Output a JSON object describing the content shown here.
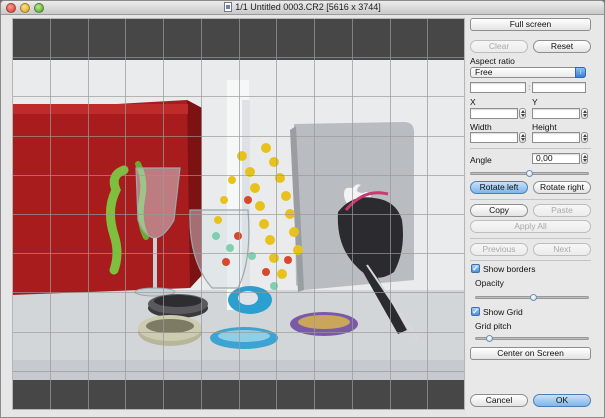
{
  "window": {
    "title": "1/1 Untitled 0003.CR2 [5616 x 3744]"
  },
  "panel": {
    "full_screen": "Full screen",
    "clear": "Clear",
    "reset": "Reset",
    "aspect_ratio_label": "Aspect ratio",
    "aspect_ratio_value": "Free",
    "x_label": "X",
    "y_label": "Y",
    "width_label": "Width",
    "height_label": "Height",
    "angle_label": "Angle",
    "angle_value": "0,00",
    "rotate_left": "Rotate left",
    "rotate_right": "Rotate right",
    "copy": "Copy",
    "paste": "Paste",
    "apply_all": "Apply All",
    "previous": "Previous",
    "next": "Next",
    "show_borders": "Show borders",
    "opacity_label": "Opacity",
    "show_grid": "Show Grid",
    "grid_pitch_label": "Grid pitch",
    "center_on_screen": "Center on Screen",
    "cancel": "Cancel",
    "ok": "OK"
  },
  "state": {
    "show_borders_checked": true,
    "show_grid_checked": true,
    "angle_slider_level": 0.5,
    "opacity_slider_level": 0.5,
    "grid_pitch_slider_level": 0.1
  },
  "icons": {
    "close": "close-icon",
    "minimize": "minimize-icon",
    "zoom": "zoom-icon",
    "document": "document-icon",
    "checkmark": "checkmark-icon",
    "select_arrows": "updown-arrows-icon"
  },
  "colors": {
    "accent_blue": "#4a8fdb",
    "canvas_border": "#474747",
    "red_box": "#a81c1e",
    "laptop_silver": "#b9bcc0",
    "bead_yellow": "#e8c21c",
    "bead_green": "#7fbf3f",
    "teal_bracelet": "#2a9fd0"
  }
}
